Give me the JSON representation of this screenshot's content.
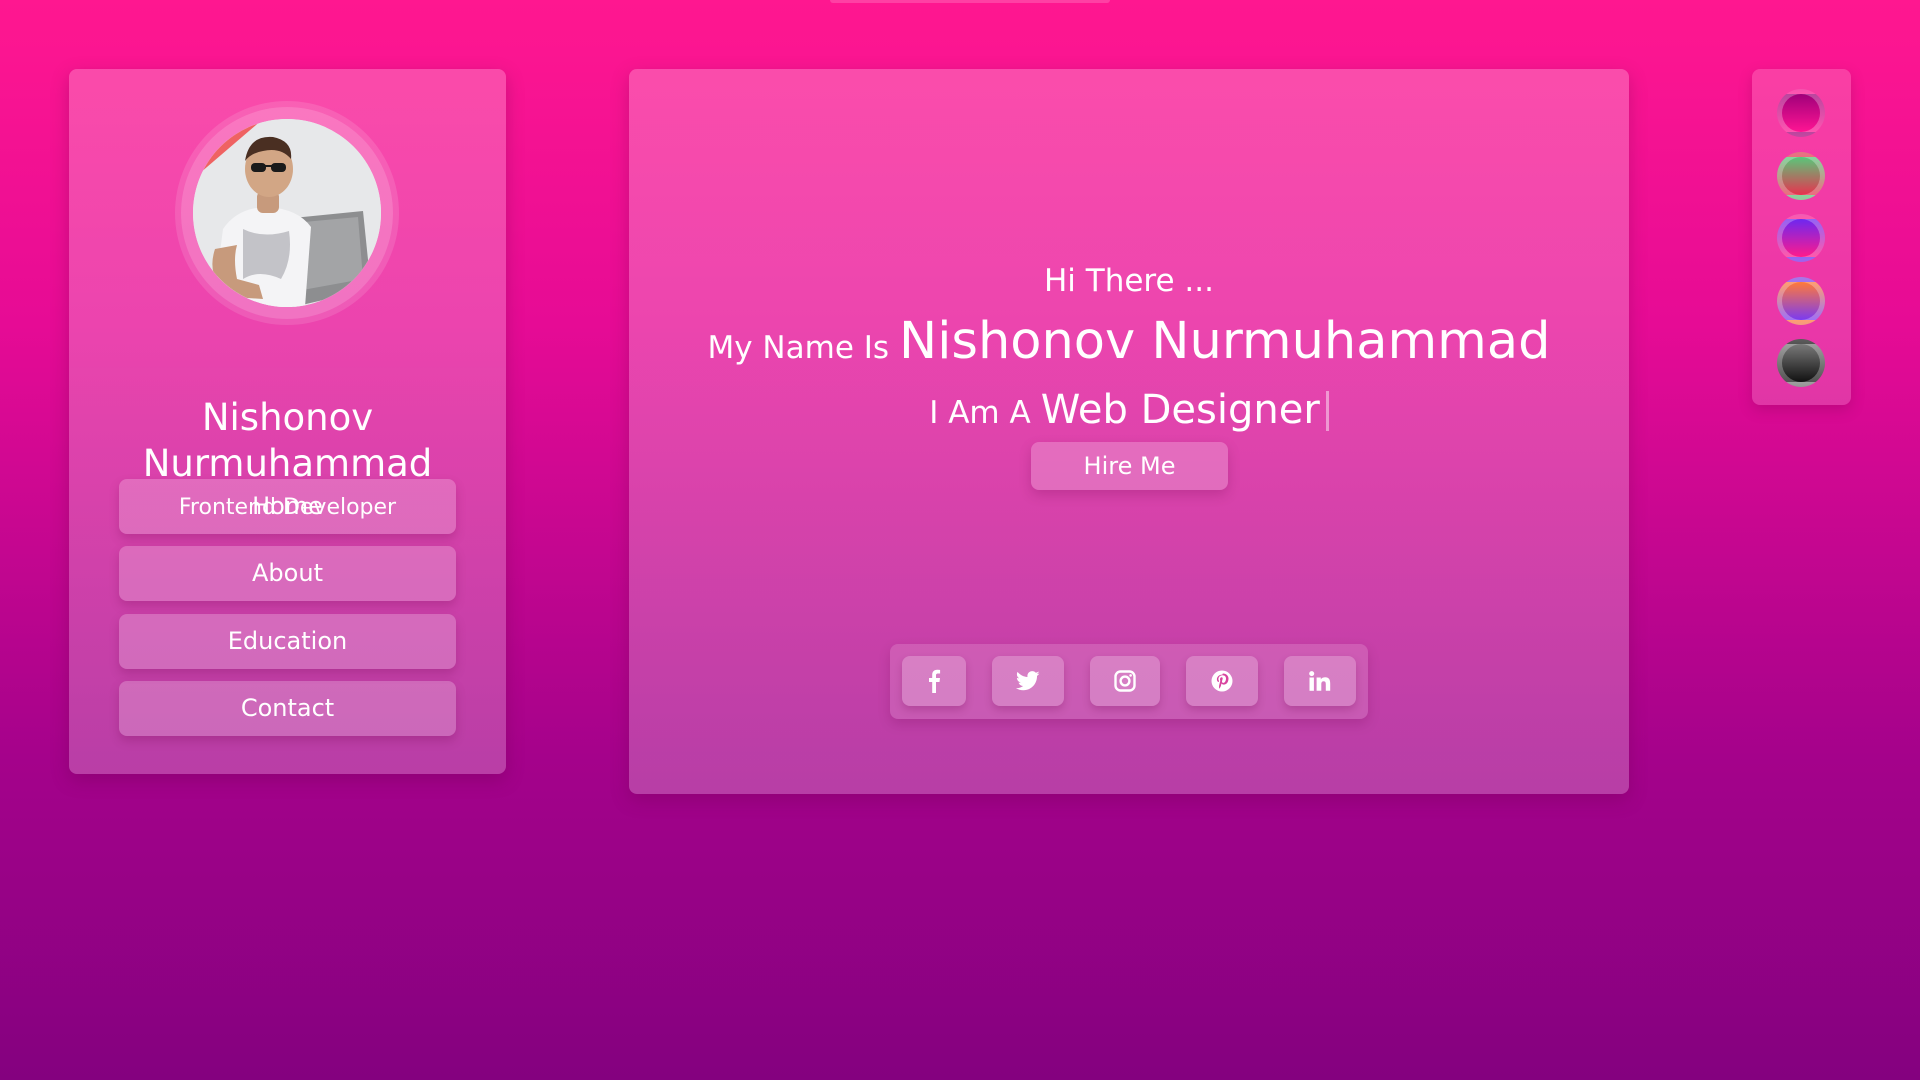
{
  "profile": {
    "name": "Nishonov Nurmuhammad",
    "name_line1": "Nishonov",
    "name_line2": "Nurmuhammad",
    "role": "Frontend Developer"
  },
  "nav": {
    "items": [
      {
        "label": "Home"
      },
      {
        "label": "About"
      },
      {
        "label": "Education"
      },
      {
        "label": "Contact"
      }
    ]
  },
  "hero": {
    "greeting": "Hi There ...",
    "name_prefix": "My Name Is",
    "name": "Nishonov Nurmuhammad",
    "role_prefix": "I Am A",
    "role": "Web Designer",
    "hire_label": "Hire Me"
  },
  "social": {
    "icons": [
      "facebook-icon",
      "twitter-icon",
      "instagram-icon",
      "pinterest-icon",
      "linkedin-icon"
    ]
  },
  "themes": {
    "swatches": [
      {
        "name": "magenta",
        "from": "#a0007a",
        "to": "#ff1493"
      },
      {
        "name": "green-red",
        "from": "#59c77a",
        "to": "#e8324f"
      },
      {
        "name": "purple-pink",
        "from": "#6d28f0",
        "to": "#ff1a8c"
      },
      {
        "name": "orange-violet",
        "from": "#ff7a3a",
        "to": "#7b3bf0"
      },
      {
        "name": "dark",
        "from": "#7a7a7a",
        "to": "#111111"
      }
    ]
  },
  "colors": {
    "background_top": "#ff1790",
    "background_bottom": "#84017f",
    "text": "#ffffff"
  }
}
